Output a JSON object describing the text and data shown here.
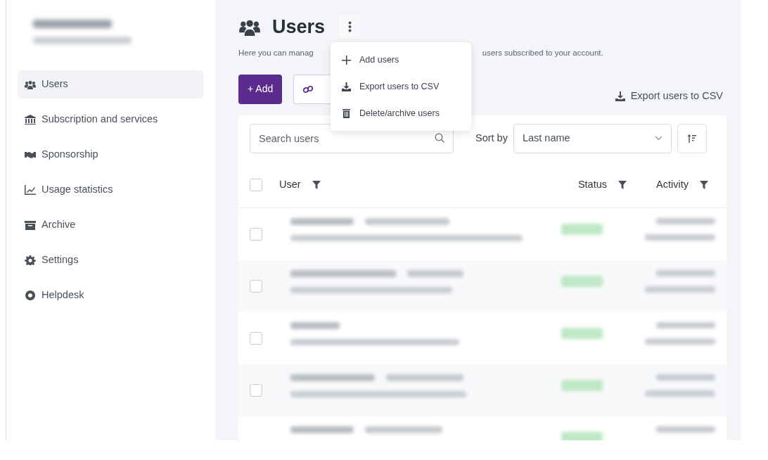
{
  "account": {
    "blurred": true
  },
  "sidebar": {
    "items": [
      {
        "label": "Users",
        "selected": true
      },
      {
        "label": "Subscription and services",
        "selected": false
      },
      {
        "label": "Sponsorship",
        "selected": false
      },
      {
        "label": "Usage statistics",
        "selected": false
      },
      {
        "label": "Archive",
        "selected": false
      },
      {
        "label": "Settings",
        "selected": false
      },
      {
        "label": "Helpdesk",
        "selected": false
      }
    ]
  },
  "page": {
    "title": "Users",
    "description_left": "Here you can manag",
    "description_right": "users subscribed to your account."
  },
  "menu": {
    "items": [
      {
        "label": "Add users"
      },
      {
        "label": "Export users to CSV"
      },
      {
        "label": "Delete/archive users"
      }
    ]
  },
  "toolbar": {
    "add_button": "+ Add",
    "export_link": "Export users to CSV"
  },
  "filters": {
    "search_placeholder": "Search users",
    "sort_label": "Sort by",
    "sort_value": "Last name"
  },
  "table": {
    "select_all": {
      "checked": false
    },
    "columns": [
      "User",
      "Status",
      "Activity"
    ],
    "rows": [
      {
        "kind": "blurred",
        "checked": false
      },
      {
        "kind": "blurred",
        "checked": false
      },
      {
        "kind": "blurred",
        "checked": false
      },
      {
        "kind": "blurred",
        "checked": false
      },
      {
        "kind": "blurred"
      }
    ]
  }
}
